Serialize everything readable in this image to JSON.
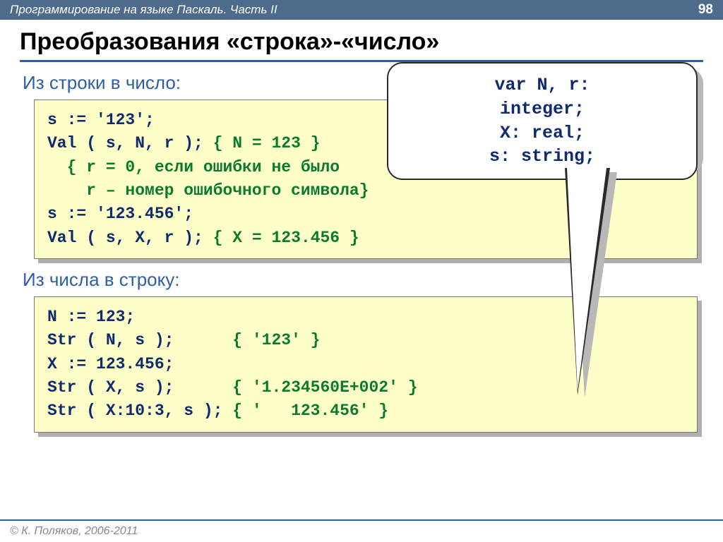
{
  "topbar": {
    "breadcrumb": "Программирование на языке Паскаль. Часть II",
    "page": "98"
  },
  "title": "Преобразования «строка»-«число»",
  "section1": {
    "label": "Из строки в число:",
    "line1a": "s := '123';",
    "line2a": "Val ( s, ",
    "line2b": "N",
    "line2c": ", r ); ",
    "line2d": "{ N = 123 }",
    "line3": "  { r = 0, если ошибки не было",
    "line4": "    r – номер ошибочного символа}",
    "line5": "s := '123.456';",
    "line6a": "Val ( s, ",
    "line6b": "X",
    "line6c": ", r ); ",
    "line6d": "{ X = 123.456 }"
  },
  "section2": {
    "label": "Из числа в строку:",
    "line1": "N := 123;",
    "line2a": "Str ( N, s );      ",
    "line2b": "{ '123' }",
    "line3": "X := 123.456;",
    "line4a": "Str ( X, s );      ",
    "line4b": "{ '1.234560E+002' }",
    "line5a": "Str ( X:10:3, s ); ",
    "line5b": "{ '   123.456' }"
  },
  "callout": {
    "l1": "var N, r:",
    "l2": "integer;",
    "l3": "X: real;",
    "l4": "s: string;"
  },
  "footer": "© К. Поляков, 2006-2011"
}
